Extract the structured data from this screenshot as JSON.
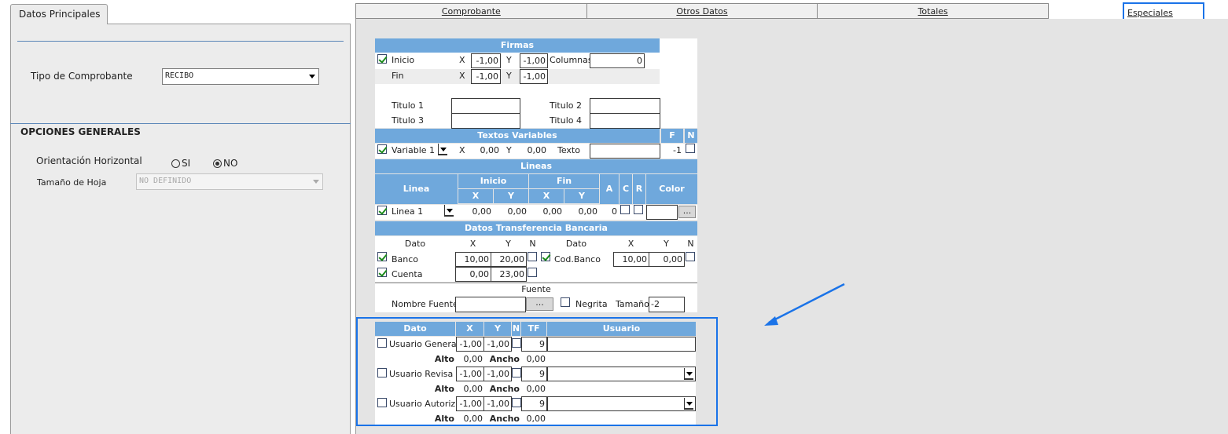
{
  "left": {
    "tab": "Datos Principales",
    "tipo_label": "Tipo de Comprobante",
    "tipo_value": "RECIBO",
    "opciones_title": "OPCIONES GENERALES",
    "orientacion_label": "Orientación Horizontal",
    "si_label": "SI",
    "no_label": "NO",
    "orientacion_selected": "NO",
    "tamano_label": "Tamaño de Hoja",
    "tamano_value": "NO DEFINIDO"
  },
  "tabs": [
    "Comprobante",
    "Otros Datos",
    "Totales",
    "Especiales"
  ],
  "firmas": {
    "title": "Firmas",
    "inicio": "Inicio",
    "inicio_checked": true,
    "fin": "Fin",
    "x": "X",
    "y": "Y",
    "inicio_x": "-1,00",
    "inicio_y": "-1,00",
    "fin_x": "-1,00",
    "fin_y": "-1,00",
    "columnas_label": "Columnas",
    "columnas_value": "0",
    "titulo1": "Titulo 1",
    "titulo2": "Titulo 2",
    "titulo3": "Titulo 3",
    "titulo4": "Titulo 4"
  },
  "textos": {
    "title": "Textos Variables",
    "f": "F",
    "n": "N",
    "variable": "Variable 1",
    "x_val": "0,00",
    "y_val": "0,00",
    "texto_label": "Texto",
    "f_val": "-1"
  },
  "lineas": {
    "title": "Lineas",
    "col_linea": "Linea",
    "col_inicio": "Inicio",
    "col_fin": "Fin",
    "a": "A",
    "c": "C",
    "r": "R",
    "color": "Color",
    "x": "X",
    "y": "Y",
    "linea_value": "Linea 1",
    "ix": "0,00",
    "iy": "0,00",
    "fx": "0,00",
    "fy": "0,00",
    "a_val": "0",
    "ellipsis": "..."
  },
  "banco": {
    "title": "Datos Transferencia Bancaria",
    "dato": "Dato",
    "x": "X",
    "y": "Y",
    "n": "N",
    "banco_label": "Banco",
    "banco_x": "10,00",
    "banco_y": "20,00",
    "cuenta_label": "Cuenta",
    "cuenta_x": "0,00",
    "cuenta_y": "23,00",
    "cod_label": "Cod.Banco",
    "cod_x": "10,00",
    "cod_y": "0,00"
  },
  "fuente": {
    "title": "Fuente",
    "nombre_label": "Nombre Fuente",
    "ellipsis": "...",
    "negrita": "Negrita",
    "tamano_label": "Tamaño",
    "tamano_value": "-2"
  },
  "usuarios": {
    "dato": "Dato",
    "x": "X",
    "y": "Y",
    "n": "N",
    "tf": "TF",
    "usuario": "Usuario",
    "alto": "Alto",
    "ancho": "Ancho",
    "rows": [
      {
        "label": "Usuario Genera",
        "x": "-1,00",
        "y": "-1,00",
        "tf": "9",
        "alto": "0,00",
        "ancho": "0,00"
      },
      {
        "label": "Usuario Revisa",
        "x": "-1,00",
        "y": "-1,00",
        "tf": "9",
        "alto": "0,00",
        "ancho": "0,00"
      },
      {
        "label": "Usuario Autoriza",
        "x": "-1,00",
        "y": "-1,00",
        "tf": "9",
        "alto": "0,00",
        "ancho": "0,00"
      }
    ]
  },
  "colors": {
    "header_blue": "#6fa8dc",
    "highlight": "#1a73e8",
    "divider": "#5a86b8"
  }
}
